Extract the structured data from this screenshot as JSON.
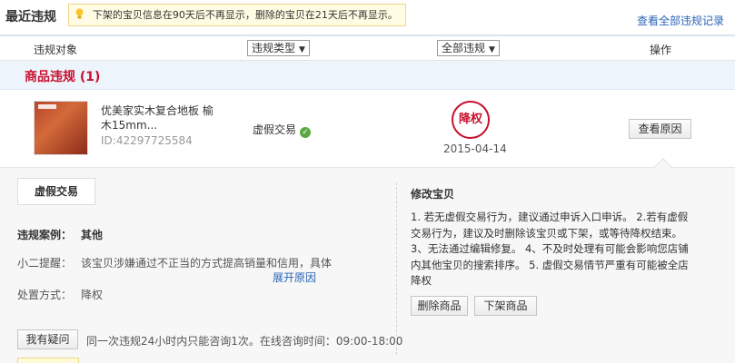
{
  "header": {
    "title": "最近违规",
    "tip": "下架的宝贝信息在90天后不再显示，删除的宝贝在21天后不再显示。",
    "view_all": "查看全部违规记录"
  },
  "columns": {
    "target": "违规对象",
    "type_filter": "违规类型",
    "all_filter": "全部违规",
    "action": "操作"
  },
  "section": {
    "title": "商品违规 (1)"
  },
  "violation": {
    "product_name": "优美家实木复合地板 榆木15mm...",
    "product_id": "ID:42297725584",
    "type": "虚假交易",
    "penalty": "降权",
    "date": "2015-04-14",
    "reason_button": "查看原因"
  },
  "detail": {
    "tab": "虚假交易",
    "case_label": "违规案例：",
    "case_value": "其他",
    "reminder_label": "小二提醒：",
    "reminder_value": "该宝贝涉嫌通过不正当的方式提高销量和信用，具体",
    "expand_link": "展开原因",
    "handle_label": "处置方式：",
    "handle_value": "降权",
    "ask_button": "我有疑问",
    "ask_note": "同一次违规24小时内只能咨询1次。在线咨询时间：09:00-18:00"
  },
  "fix": {
    "title": "修改宝贝",
    "text": "1. 若无虚假交易行为，建议通过申诉入口申诉。 2.若有虚假交易行为，建议及时删除该宝贝或下架，或等待降权结束。 3、无法通过编辑修复。 4、不及时处理有可能会影响您店铺内其他宝贝的搜索排序。 5. 虚假交易情节严重有可能被全店降权",
    "delete_button": "删除商品",
    "offshelf_button": "下架商品"
  },
  "colors": {
    "accent_red": "#c8102e",
    "link_blue": "#2a64b4"
  }
}
